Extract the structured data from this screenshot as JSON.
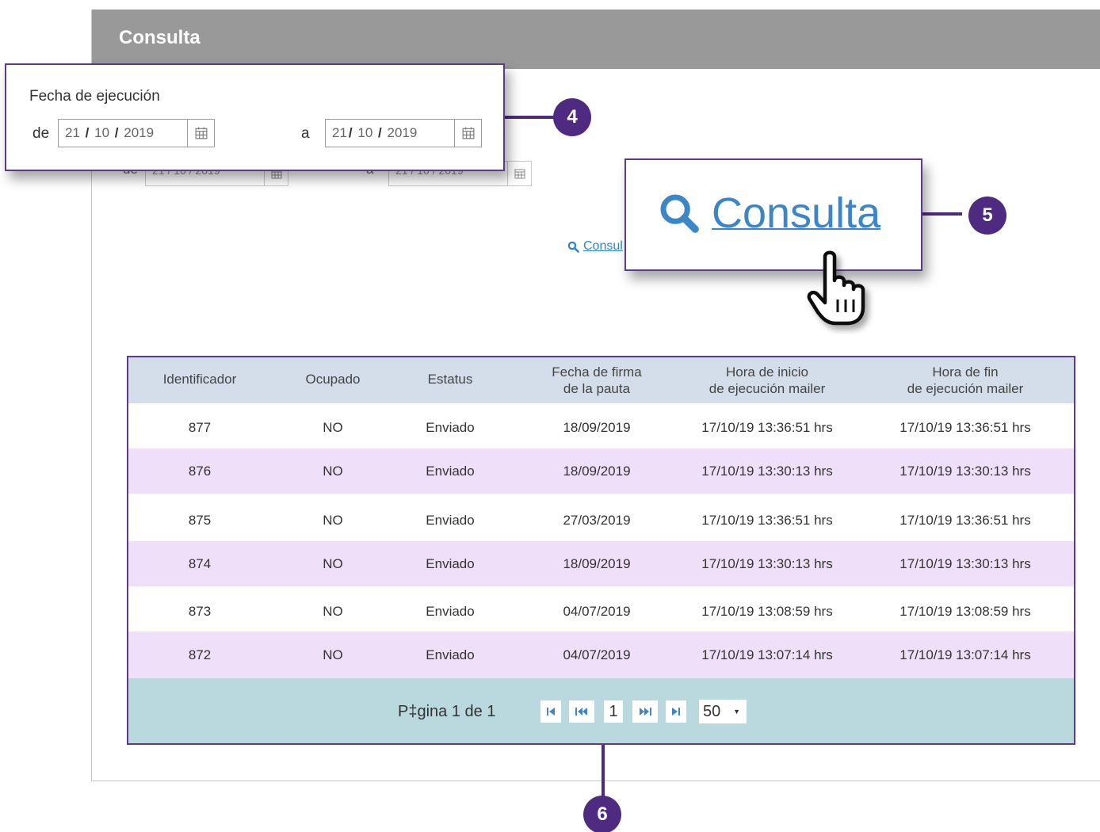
{
  "panel": {
    "title": "Consulta"
  },
  "background_form": {
    "de_label": "de",
    "a_label": "a",
    "from_value": "21 / 10 / 2019",
    "to_value": "21 / 10 / 2019",
    "search_link": "Consul"
  },
  "date_callout": {
    "label": "Fecha de ejecución",
    "de_label": "de",
    "a_label": "a",
    "from": {
      "day": "21",
      "month": "10",
      "year": "2019"
    },
    "to": {
      "day": "21",
      "month": "10",
      "year": "2019"
    }
  },
  "consulta_callout": {
    "label": "Consulta"
  },
  "badges": {
    "date": "4",
    "consulta": "5",
    "table": "6"
  },
  "table": {
    "headers": [
      {
        "line1": "Identificador",
        "line2": ""
      },
      {
        "line1": "Ocupado",
        "line2": ""
      },
      {
        "line1": "Estatus",
        "line2": ""
      },
      {
        "line1": "Fecha de firma",
        "line2": "de la pauta"
      },
      {
        "line1": "Hora de inicio",
        "line2": "de ejecución mailer"
      },
      {
        "line1": "Hora de fin",
        "line2": "de ejecución mailer"
      }
    ],
    "rows": [
      [
        "877",
        "NO",
        "Enviado",
        "18/09/2019",
        "17/10/19 13:36:51 hrs",
        "17/10/19 13:36:51 hrs"
      ],
      [
        "876",
        "NO",
        "Enviado",
        "18/09/2019",
        "17/10/19 13:30:13 hrs",
        "17/10/19 13:30:13 hrs"
      ],
      [
        "875",
        "NO",
        "Enviado",
        "27/03/2019",
        "17/10/19 13:36:51 hrs",
        "17/10/19 13:36:51 hrs"
      ],
      [
        "874",
        "NO",
        "Enviado",
        "18/09/2019",
        "17/10/19 13:30:13 hrs",
        "17/10/19 13:30:13 hrs"
      ],
      [
        "873",
        "NO",
        "Enviado",
        "04/07/2019",
        "17/10/19 13:08:59 hrs",
        "17/10/19 13:08:59 hrs"
      ],
      [
        "872",
        "NO",
        "Enviado",
        "04/07/2019",
        "17/10/19 13:07:14 hrs",
        "17/10/19 13:07:14 hrs"
      ]
    ],
    "pager": {
      "text": "P‡gina 1 de 1",
      "current_page": "1",
      "page_size": "50"
    }
  },
  "colors": {
    "accent": "#4e2b80",
    "link": "#3d86c6",
    "header_bg": "#999999",
    "table_head": "#d4deea",
    "row_alt": "#efdff8",
    "pager_bg": "#b9d9de"
  },
  "icons": [
    "calendar-icon",
    "search-icon",
    "hand-pointer-icon",
    "first-page-icon",
    "previous-page-icon",
    "next-page-icon",
    "last-page-icon",
    "dropdown-caret-icon"
  ]
}
